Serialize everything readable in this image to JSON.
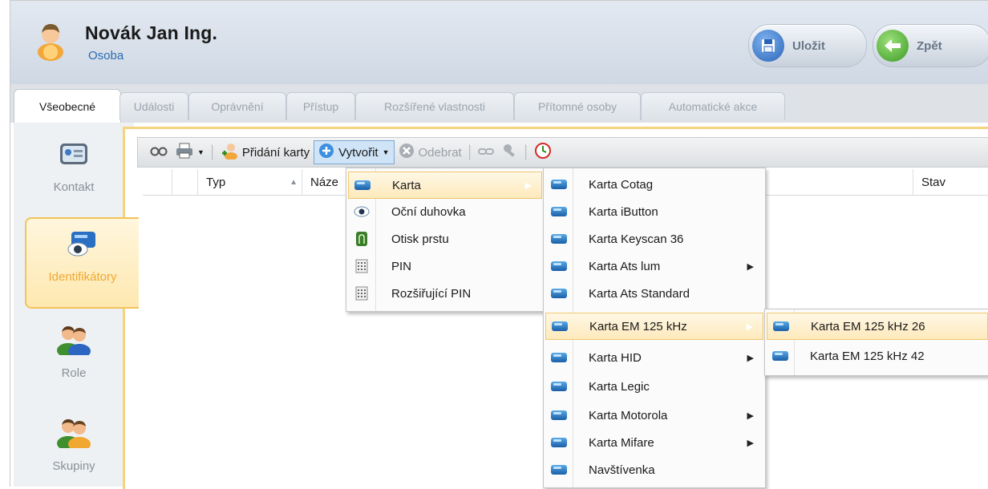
{
  "header": {
    "title": "Novák Jan Ing.",
    "subtitle": "Osoba",
    "save_label": "Uložit",
    "back_label": "Zpět"
  },
  "tabs": [
    {
      "label": "Všeobecné"
    },
    {
      "label": "Události"
    },
    {
      "label": "Oprávnění"
    },
    {
      "label": "Přístup"
    },
    {
      "label": "Rozšířené vlastnosti"
    },
    {
      "label": "Přítomné osoby"
    },
    {
      "label": "Automatické akce"
    }
  ],
  "sidebar": {
    "items": [
      {
        "label": "Kontakt",
        "icon": "contact-card-icon"
      },
      {
        "label": "Identifikátory",
        "icon": "eye-card-icon"
      },
      {
        "label": "Role",
        "icon": "users-icon"
      },
      {
        "label": "Skupiny",
        "icon": "group-icon"
      }
    ]
  },
  "toolbar": {
    "add_card_label": "Přidání karty",
    "create_label": "Vytvořit",
    "remove_label": "Odebrat"
  },
  "grid": {
    "columns": [
      "Typ",
      "Náze",
      "Stav"
    ]
  },
  "menu_create": {
    "items": [
      "Karta",
      "Oční duhovka",
      "Otisk prstu",
      "PIN",
      "Rozšiřující PIN"
    ]
  },
  "menu_karta": {
    "items": [
      "Karta Cotag",
      "Karta iButton",
      "Karta Keyscan 36",
      "Karta Ats lum",
      "Karta Ats Standard",
      "Karta EM 125 kHz",
      "Karta HID",
      "Karta Legic",
      "Karta Motorola",
      "Karta Mifare",
      "Navštívenka"
    ]
  },
  "menu_em": {
    "items": [
      "Karta EM 125 kHz 26",
      "Karta EM 125 kHz 42"
    ]
  },
  "colors": {
    "accent_orange": "#f2c45a",
    "link_blue": "#2b6cb0"
  }
}
